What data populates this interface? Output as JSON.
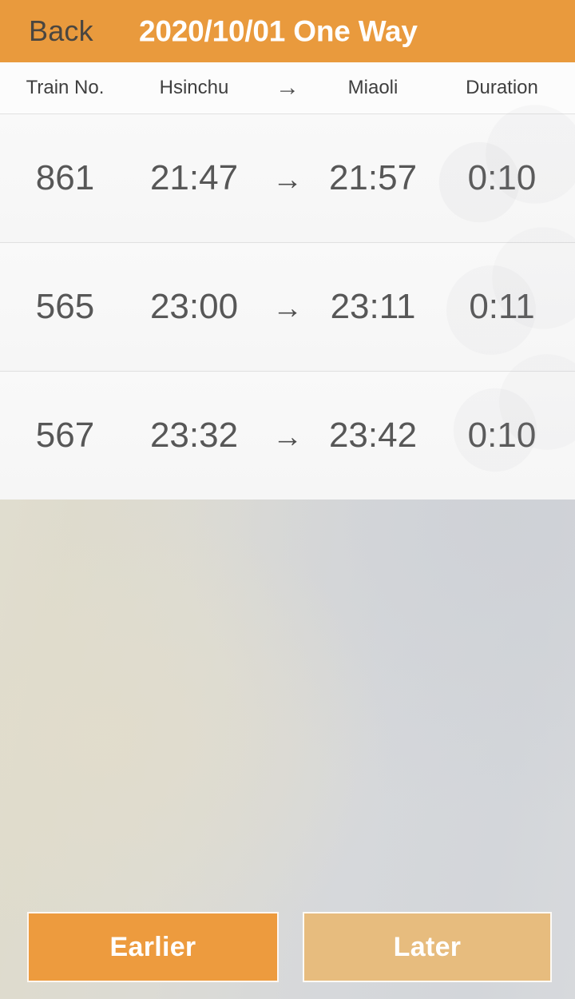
{
  "topbar": {
    "back_label": "Back",
    "title": "2020/10/01 One Way",
    "background_color": "#e99a3d",
    "title_color": "#ffffff",
    "back_color": "#4a4640"
  },
  "table": {
    "columns": {
      "train_no": "Train No.",
      "origin": "Hsinchu",
      "arrow": "→",
      "destination": "Miaoli",
      "duration": "Duration"
    },
    "rows": [
      {
        "train_no": "861",
        "depart": "21:47",
        "arrow": "→",
        "arrive": "21:57",
        "duration": "0:10"
      },
      {
        "train_no": "565",
        "depart": "23:00",
        "arrow": "→",
        "arrive": "23:11",
        "duration": "0:11"
      },
      {
        "train_no": "567",
        "depart": "23:32",
        "arrow": "→",
        "arrive": "23:42",
        "duration": "0:10"
      }
    ]
  },
  "footer": {
    "earlier_label": "Earlier",
    "later_label": "Later",
    "earlier_color": "#ed9b3e",
    "later_color": "#e7bc7e"
  }
}
